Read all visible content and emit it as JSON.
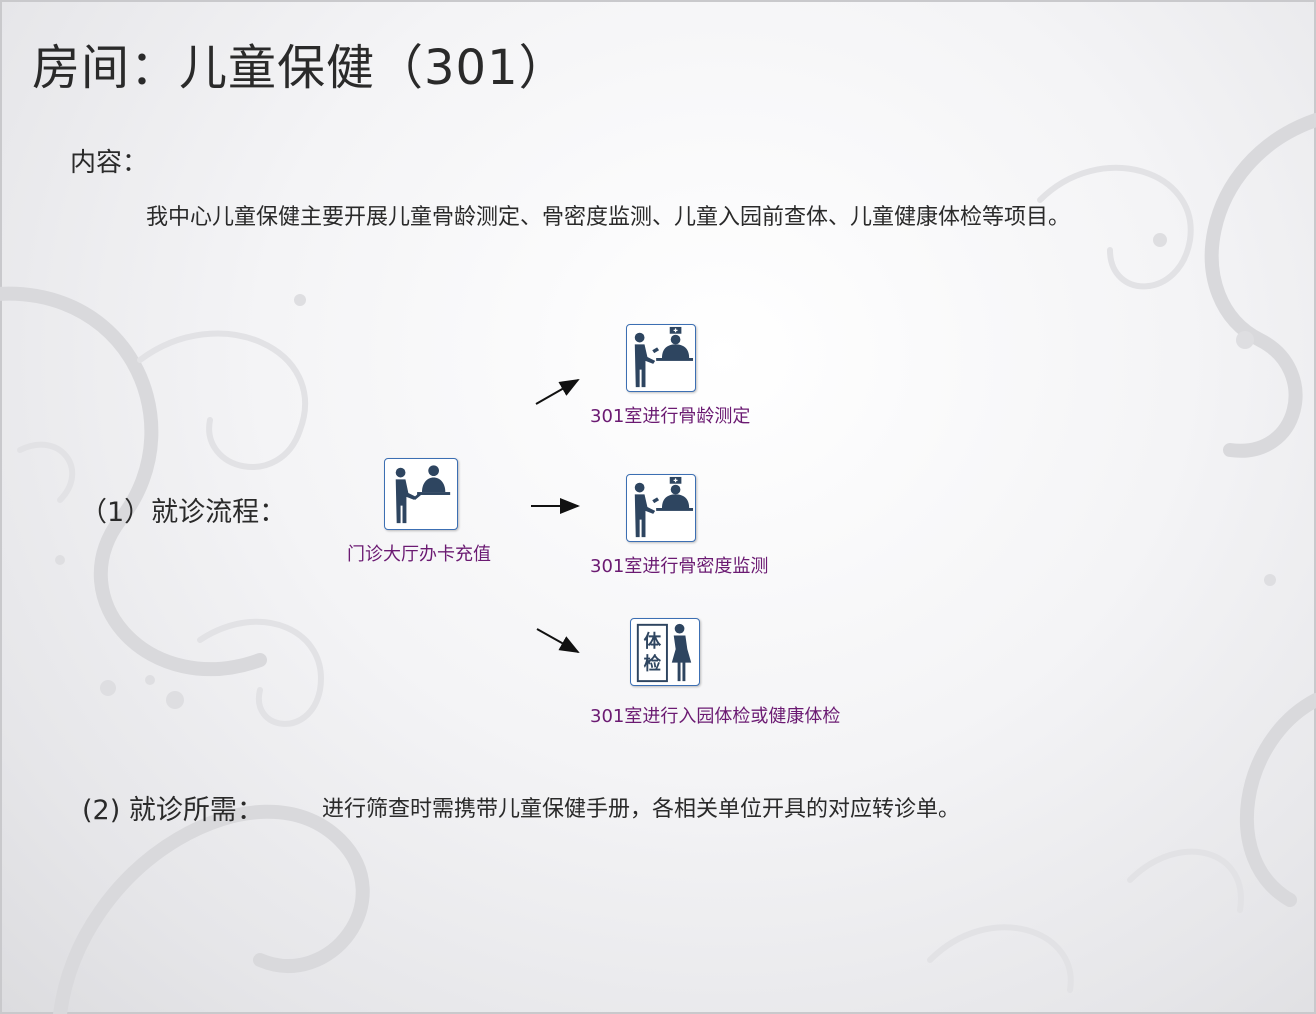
{
  "page": {
    "title": "房间：儿童保健（301）",
    "content_label": "内容：",
    "content_text": "我中心儿童保健主要开展儿童骨龄测定、骨密度监测、儿童入园前查体、儿童健康体检等项目。",
    "flow_label": "（1）就诊流程：",
    "needs_label": "(2) 就诊所需：",
    "needs_text": "进行筛查时需携带儿童保健手册，各相关单位开具的对应转诊单。"
  },
  "flow": {
    "start": {
      "label": "门诊大厅办卡充值",
      "icon": "registration-desk-icon"
    },
    "branches": [
      {
        "label": "301室进行骨龄测定",
        "icon": "doctor-consultation-icon"
      },
      {
        "label": "301室进行骨密度监测",
        "icon": "doctor-consultation-icon"
      },
      {
        "label": "301室进行入园体检或健康体检",
        "icon": "physical-exam-icon",
        "icon_text": "体检"
      }
    ]
  },
  "colors": {
    "icon_border": "#3c6fb3",
    "icon_figure": "#2e4560",
    "step_label": "#6b1a72",
    "text": "#2a2a2a"
  }
}
